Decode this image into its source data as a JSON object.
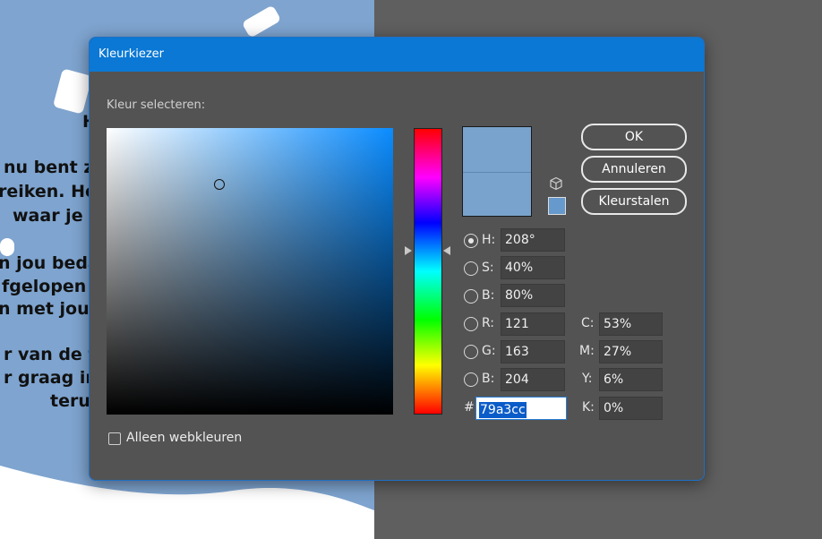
{
  "background": {
    "lines": [
      "H",
      "nu bent z",
      "reiken. Het",
      "waar je z",
      "n jou beda",
      "fgelopen j",
      "n met jou",
      "r van de fe",
      "r graag in",
      "teru"
    ]
  },
  "dialog": {
    "title": "Kleurkiezer",
    "select_label": "Kleur selecteren:",
    "buttons": {
      "ok": "OK",
      "cancel": "Annuleren",
      "swatches": "Kleurstalen"
    },
    "hsb": [
      {
        "label": "H:",
        "value": "208°",
        "selected": true
      },
      {
        "label": "S:",
        "value": "40%",
        "selected": false
      },
      {
        "label": "B:",
        "value": "80%",
        "selected": false
      }
    ],
    "rgb": [
      {
        "label": "R:",
        "value": "121"
      },
      {
        "label": "G:",
        "value": "163"
      },
      {
        "label": "B:",
        "value": "204"
      }
    ],
    "cmyk": [
      {
        "label": "C:",
        "value": "53%"
      },
      {
        "label": "M:",
        "value": "27%"
      },
      {
        "label": "Y:",
        "value": "6%"
      },
      {
        "label": "K:",
        "value": "0%"
      }
    ],
    "hex_label": "#",
    "hex_value": "79a3cc",
    "web_only_label": "Alleen webkleuren",
    "web_only_checked": false
  },
  "colors": {
    "current": "#79a3cc",
    "web_safe": "#6699cc",
    "title_bar": "#0a78d4",
    "dialog_bg": "#535353"
  }
}
